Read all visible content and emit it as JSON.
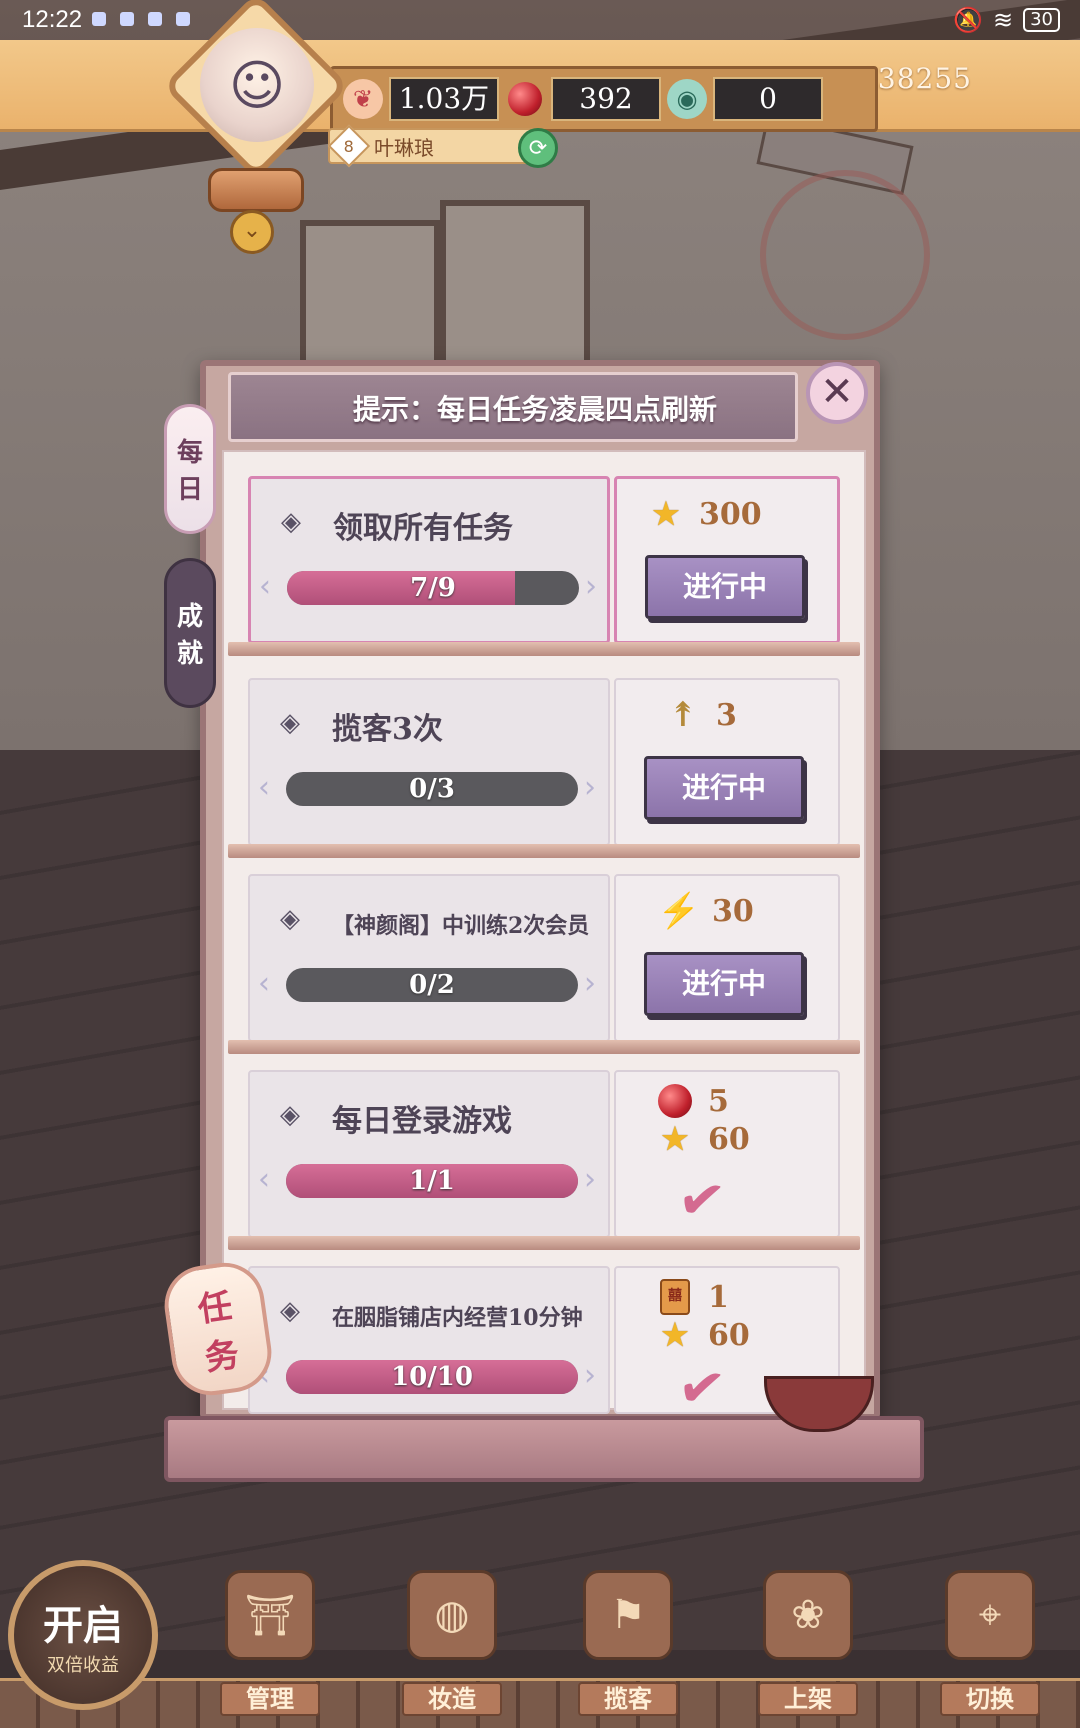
{
  "status_bar": {
    "time": "12:22",
    "battery": "30"
  },
  "header": {
    "player_id": "ID:138255",
    "player_name": "叶琳琅",
    "level": "8",
    "resources": [
      {
        "icon": "heart-icon",
        "value": "1.03万"
      },
      {
        "icon": "red-gem-icon",
        "value": "392"
      },
      {
        "icon": "jade-icon",
        "value": "0"
      }
    ]
  },
  "panel": {
    "notice": "提示：每日任务凌晨四点刷新",
    "tabs": [
      {
        "label_top": "每",
        "label_bottom": "日"
      },
      {
        "label_top": "成",
        "label_bottom": "就"
      }
    ],
    "tasks": [
      {
        "title": "领取所有任务",
        "progress_text": "7/9",
        "progress": 0.78,
        "rewards": [
          {
            "icon": "star-icon",
            "amount": "300"
          }
        ],
        "status": "进行中"
      },
      {
        "title": "揽客3次",
        "progress_text": "0/3",
        "progress": 0,
        "rewards": [
          {
            "icon": "arrow-icon",
            "amount": "3"
          }
        ],
        "status": "进行中"
      },
      {
        "title": "【神颜阁】中训练2次会员",
        "progress_text": "0/2",
        "progress": 0,
        "rewards": [
          {
            "icon": "lightning-icon",
            "amount": "30"
          }
        ],
        "status": "进行中"
      },
      {
        "title": "每日登录游戏",
        "progress_text": "1/1",
        "progress": 1,
        "rewards": [
          {
            "icon": "red-gem-icon",
            "amount": "5"
          },
          {
            "icon": "star-icon",
            "amount": "60"
          }
        ],
        "status": "done"
      },
      {
        "title": "在胭脂铺店内经营10分钟",
        "progress_text": "10/10",
        "progress": 1,
        "rewards": [
          {
            "icon": "scroll-icon",
            "amount": "1"
          },
          {
            "icon": "star-icon",
            "amount": "60"
          }
        ],
        "status": "done"
      }
    ],
    "lantern_top": "任",
    "lantern_bottom": "务"
  },
  "bottom_nav": {
    "double_main": "开启",
    "double_sub": "双倍收益",
    "items": [
      {
        "label": "管理",
        "icon": "gate-icon"
      },
      {
        "label": "妆造",
        "icon": "mirror-icon"
      },
      {
        "label": "揽客",
        "icon": "signpost-icon"
      },
      {
        "label": "上架",
        "icon": "shelf-icon"
      },
      {
        "label": "切换",
        "icon": "map-icon"
      }
    ]
  },
  "colors": {
    "accent": "#d66e97",
    "button": "#9a83b8",
    "header": "#f2c88a"
  }
}
